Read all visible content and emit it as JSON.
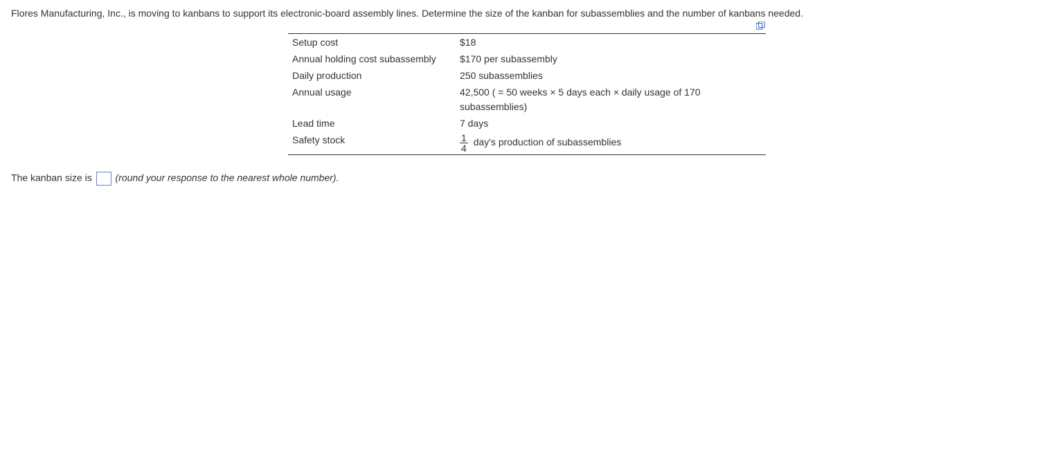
{
  "problem": {
    "text": "Flores Manufacturing, Inc., is moving to kanbans to support its electronic-board assembly lines. Determine the size of the kanban for subassemblies and the number of kanbans needed."
  },
  "table": {
    "rows": [
      {
        "label": "Setup cost",
        "value": "$18"
      },
      {
        "label": "Annual holding cost subassembly",
        "value": "$170 per subassembly"
      },
      {
        "label": "Daily production",
        "value": "250 subassemblies"
      },
      {
        "label": "Annual usage",
        "value": "42,500 ( = 50 weeks × 5 days each × daily usage of  170 subassemblies)"
      },
      {
        "label": "Lead time",
        "value": "7 days"
      },
      {
        "label": "Safety stock",
        "value_suffix": "day's production of subassemblies",
        "fraction": {
          "num": "1",
          "den": "4"
        }
      }
    ]
  },
  "answer": {
    "prefix": "The kanban size is",
    "value": "",
    "hint": "(round your response to the nearest whole number).",
    "placeholder": ""
  }
}
